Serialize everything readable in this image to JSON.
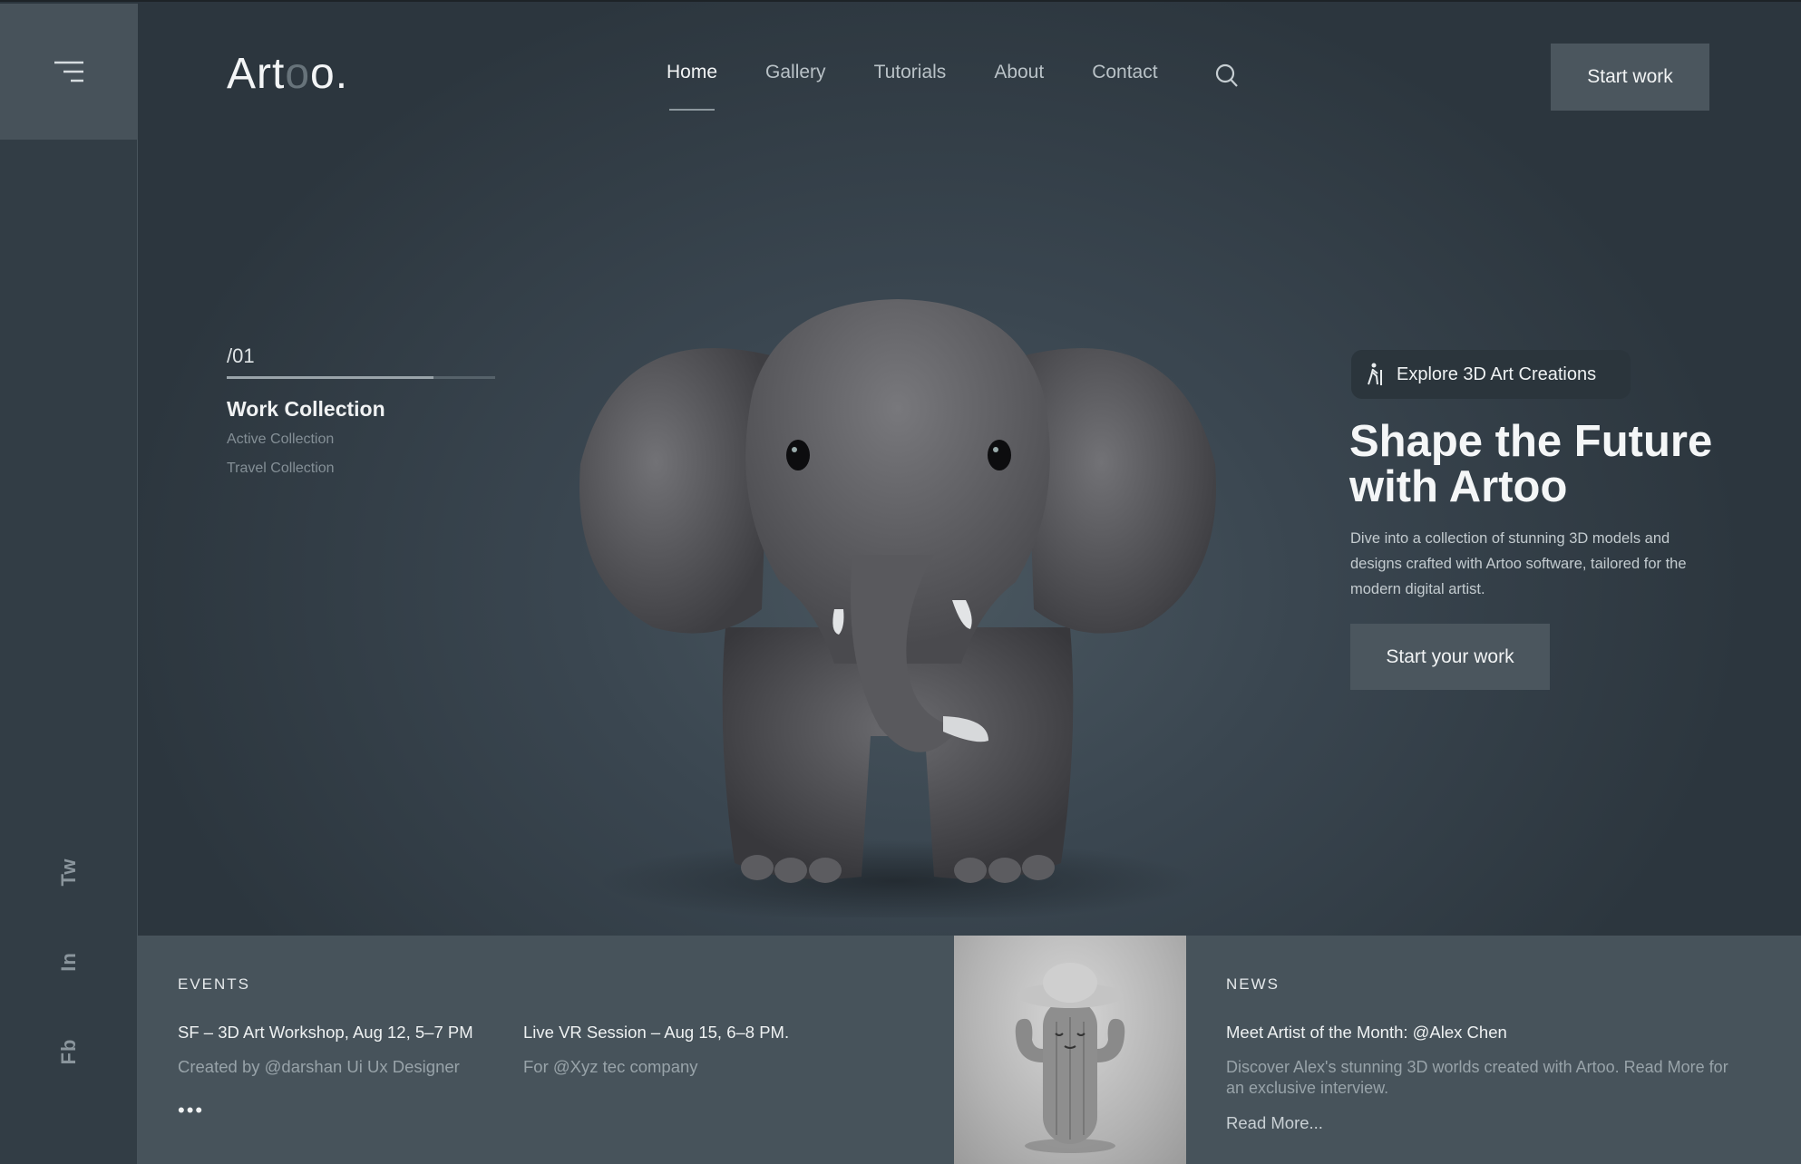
{
  "brand": {
    "logo_prefix": "Art",
    "logo_o": "o",
    "logo_suffix": "o."
  },
  "nav": {
    "items": [
      {
        "label": "Home",
        "active": true
      },
      {
        "label": "Gallery",
        "active": false
      },
      {
        "label": "Tutorials",
        "active": false
      },
      {
        "label": "About",
        "active": false
      },
      {
        "label": "Contact",
        "active": false
      }
    ],
    "search_icon": "search-icon"
  },
  "header": {
    "cta_label": "Start work"
  },
  "sidebar": {
    "menu_icon": "menu-icon",
    "social": [
      "Tw",
      "In",
      "Fb"
    ]
  },
  "collection": {
    "slide_number": "/01",
    "progress": 0.77,
    "title": "Work Collection",
    "items": [
      "Active Collection",
      "Travel Collection"
    ]
  },
  "hero": {
    "pill_label": "Explore 3D Art Creations",
    "pill_icon": "hiker-icon",
    "title": "Shape the Future with Artoo",
    "description": "Dive into a collection of stunning 3D models and designs crafted with Artoo software, tailored for the modern digital artist.",
    "cta_label": "Start your work"
  },
  "events": {
    "label": "EVENTS",
    "items": [
      {
        "title": "SF – 3D Art Workshop, Aug 12, 5–7 PM",
        "sub": "Created by @darshan Ui Ux Designer"
      },
      {
        "title": "Live VR Session – Aug 15, 6–8 PM.",
        "sub": "For @Xyz tec company"
      }
    ],
    "more": "•••"
  },
  "news": {
    "label": "NEWS",
    "title": "Meet Artist of the Month: @Alex Chen",
    "description": "Discover Alex's stunning 3D worlds created with Artoo. Read More for an exclusive interview.",
    "read_more": "Read More..."
  },
  "colors": {
    "background": "#2e3941",
    "panel": "#47535b",
    "button": "#4b565e",
    "text": "#f0f2f3"
  }
}
